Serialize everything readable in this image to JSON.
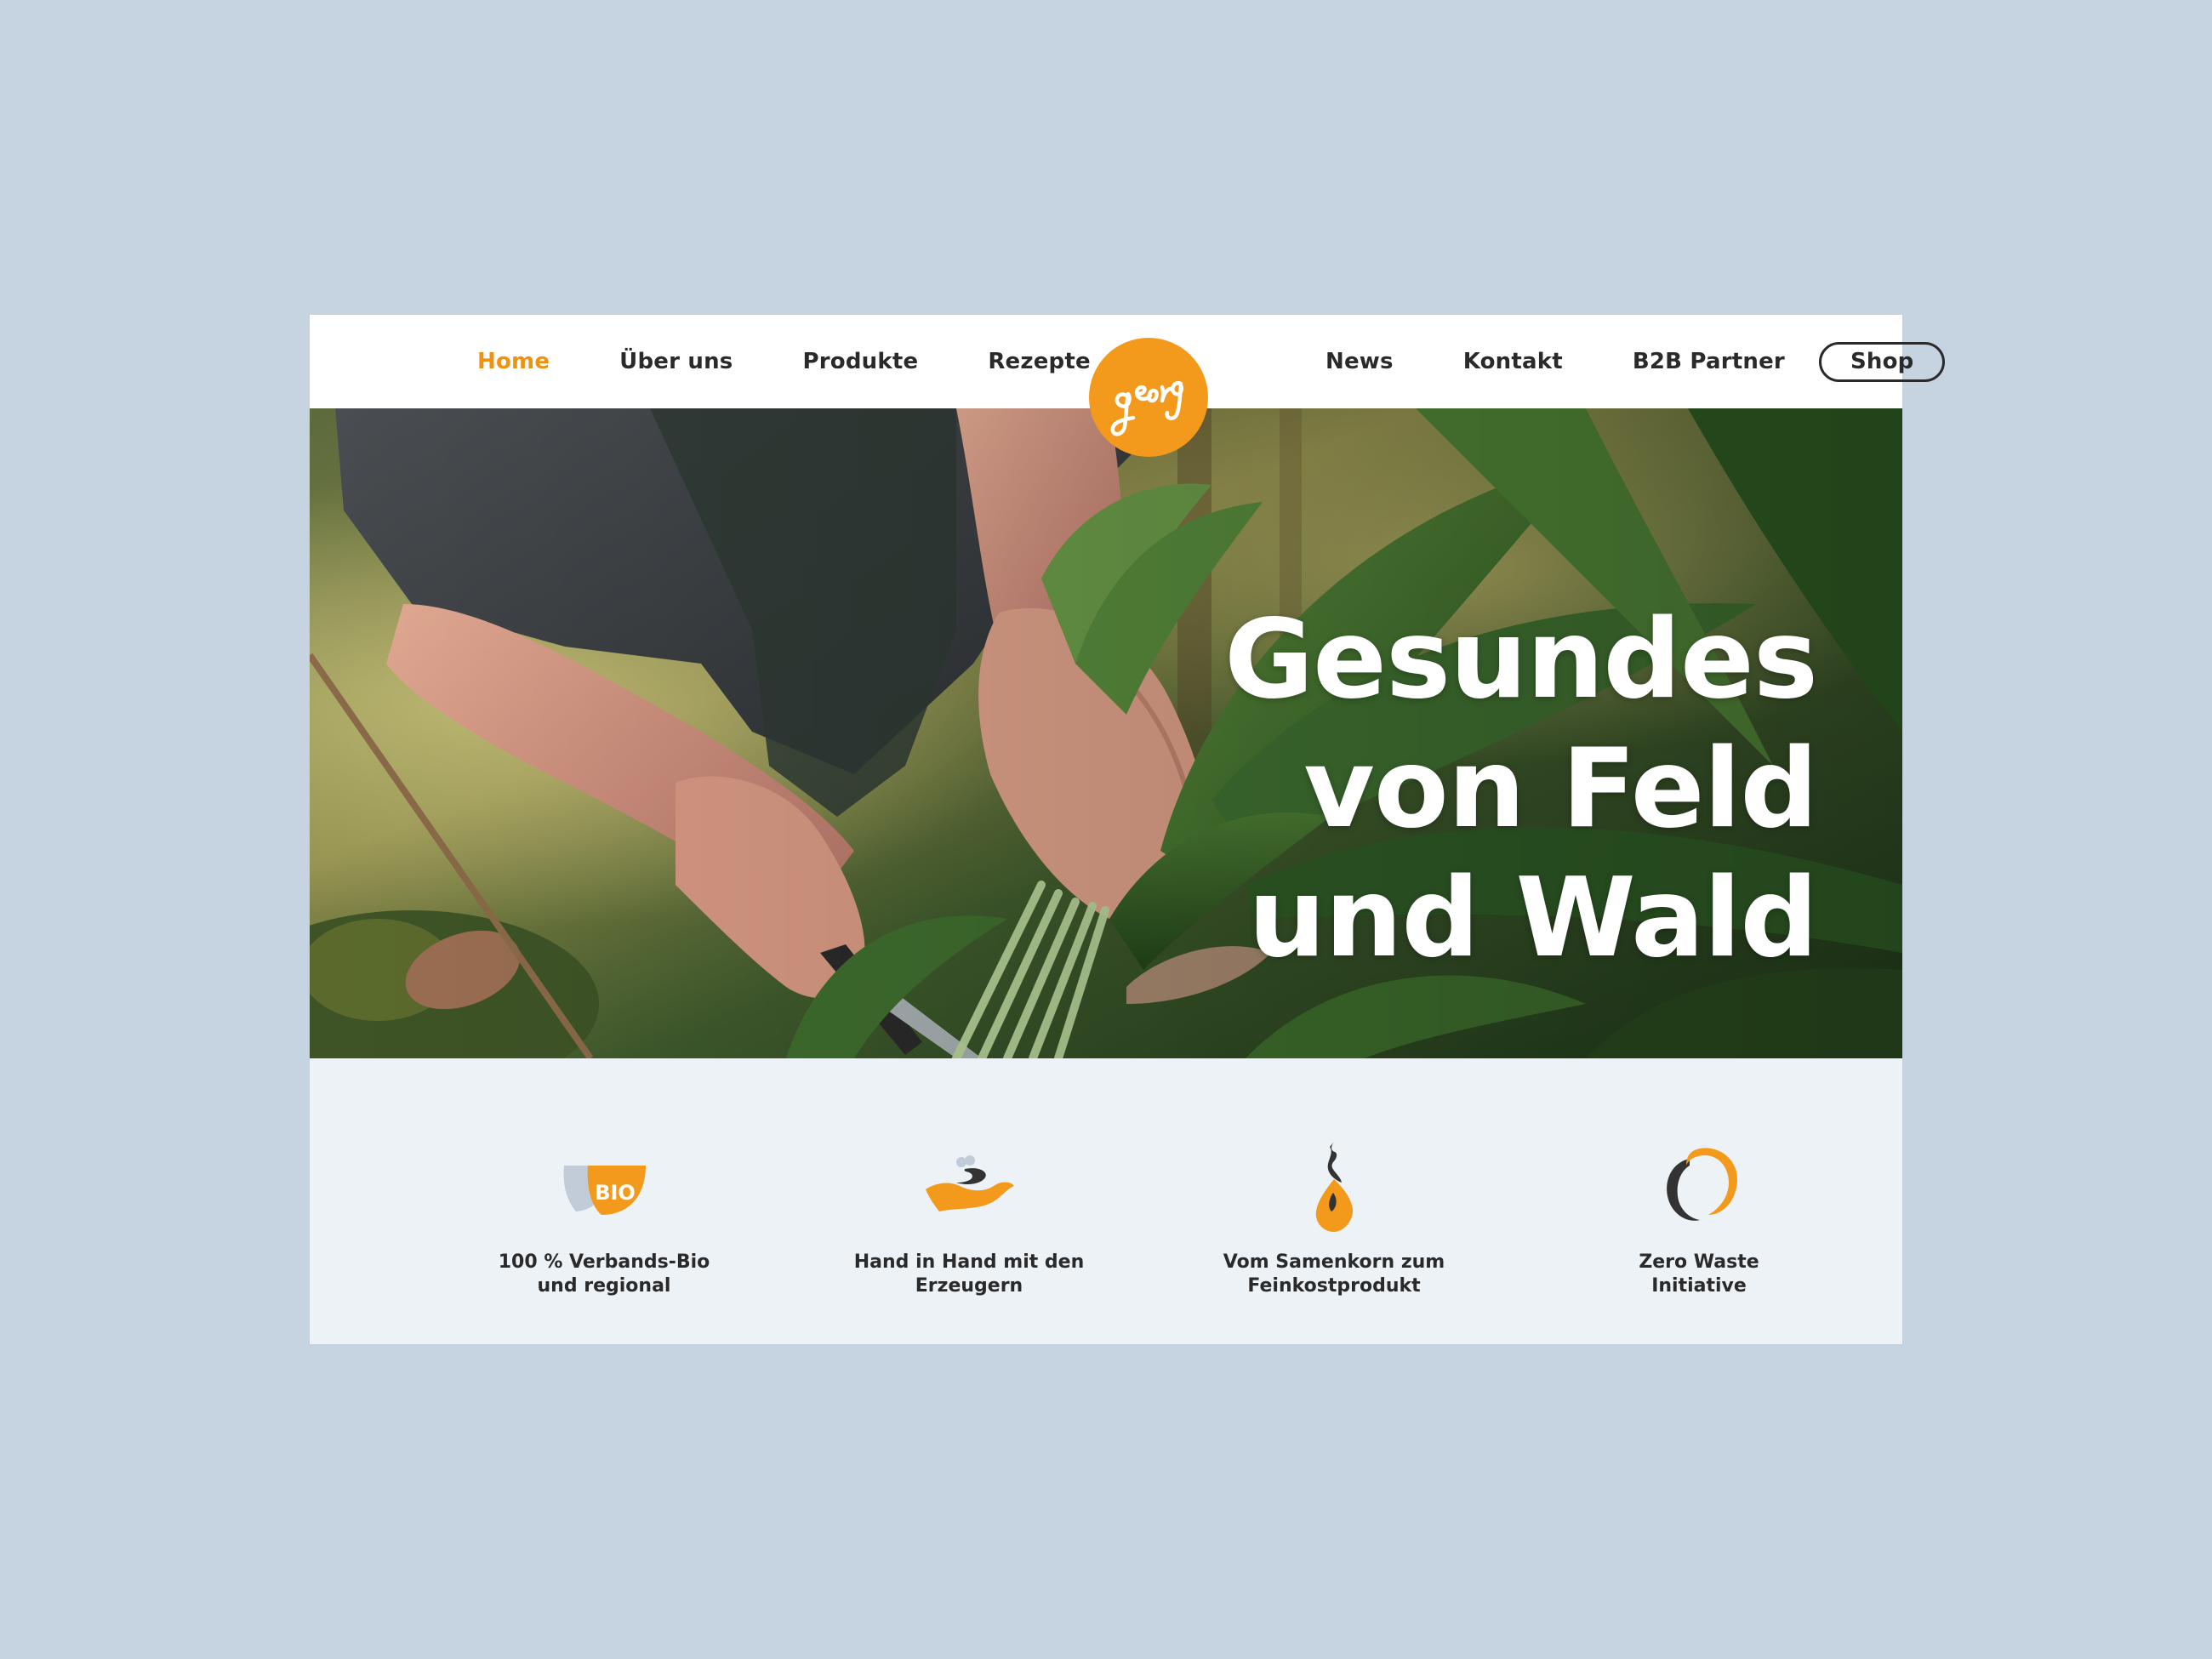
{
  "nav": {
    "left": [
      {
        "label": "Home",
        "active": true
      },
      {
        "label": "Über uns"
      },
      {
        "label": "Produkte"
      },
      {
        "label": "Rezepte"
      }
    ],
    "right": [
      {
        "label": "News"
      },
      {
        "label": "Kontakt"
      },
      {
        "label": "B2B Partner"
      }
    ],
    "shop_label": "Shop"
  },
  "logo": {
    "text": "georg",
    "color": "#f39a1c"
  },
  "hero": {
    "title_lines": [
      "Gesundes",
      "von Feld",
      "und Wald"
    ]
  },
  "features": [
    {
      "icon": "bio-leaf-icon",
      "line1": "100 % Verbands-Bio",
      "line2": "und regional",
      "badge": "BIO"
    },
    {
      "icon": "hand-icon",
      "line1": "Hand in Hand mit den",
      "line2": "Erzeugern"
    },
    {
      "icon": "seed-drop-icon",
      "line1": "Vom Samenkorn zum",
      "line2": "Feinkostprodukt"
    },
    {
      "icon": "zero-waste-icon",
      "line1": "Zero Waste",
      "line2": "Initiative"
    }
  ],
  "colors": {
    "accent": "#f39a1c",
    "text": "#2a2a2a",
    "background": "#c6d4e1",
    "panel": "#edf2f7"
  }
}
